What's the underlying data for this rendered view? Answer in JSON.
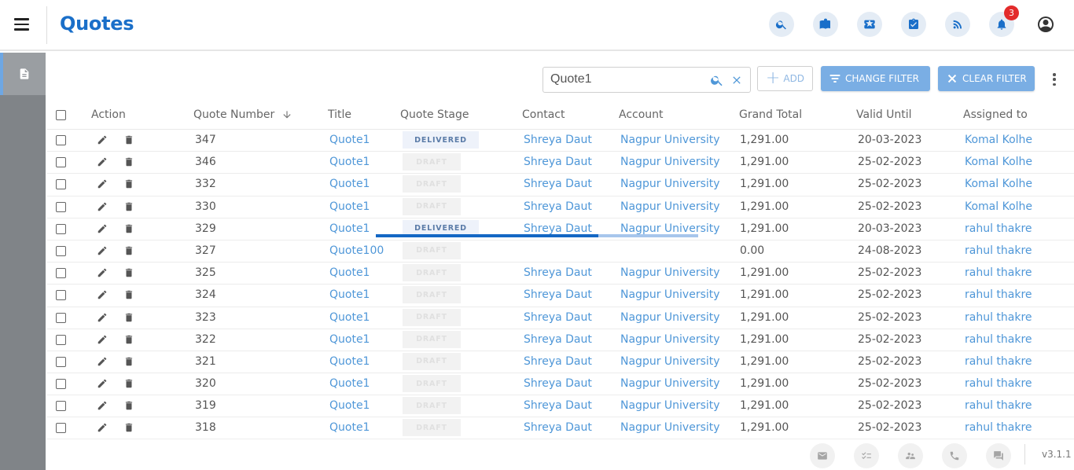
{
  "header": {
    "title": "Quotes",
    "notification_count": "3",
    "icons": [
      "search-icon",
      "book-icon",
      "ticket-icon",
      "task-icon",
      "rss-icon",
      "bell-icon",
      "account-icon"
    ]
  },
  "toolbar": {
    "search_value": "Quote1",
    "add_label": "ADD",
    "change_filter_label": "CHANGE FILTER",
    "clear_filter_label": "CLEAR FILTER"
  },
  "table": {
    "headers": {
      "action": "Action",
      "quote_number": "Quote Number",
      "title": "Title",
      "quote_stage": "Quote Stage",
      "contact": "Contact",
      "account": "Account",
      "grand_total": "Grand Total",
      "valid_until": "Valid Until",
      "assigned_to": "Assigned to"
    },
    "rows": [
      {
        "number": "347",
        "title": "Quote1",
        "stage": "DELIVERED",
        "contact": "Shreya Daut",
        "account": "Nagpur University",
        "total": "1,291.00",
        "valid": "20-03-2023",
        "assigned": "Komal Kolhe"
      },
      {
        "number": "346",
        "title": "Quote1",
        "stage": "DRAFT",
        "contact": "Shreya Daut",
        "account": "Nagpur University",
        "total": "1,291.00",
        "valid": "25-02-2023",
        "assigned": "Komal Kolhe"
      },
      {
        "number": "332",
        "title": "Quote1",
        "stage": "DRAFT",
        "contact": "Shreya Daut",
        "account": "Nagpur University",
        "total": "1,291.00",
        "valid": "25-02-2023",
        "assigned": "Komal Kolhe"
      },
      {
        "number": "330",
        "title": "Quote1",
        "stage": "DRAFT",
        "contact": "Shreya Daut",
        "account": "Nagpur University",
        "total": "1,291.00",
        "valid": "25-02-2023",
        "assigned": "Komal Kolhe"
      },
      {
        "number": "329",
        "title": "Quote1",
        "stage": "DELIVERED",
        "contact": "Shreya Daut",
        "account": "Nagpur University",
        "total": "1,291.00",
        "valid": "20-03-2023",
        "assigned": "rahul thakre"
      },
      {
        "number": "327",
        "title": "Quote100",
        "stage": "DRAFT",
        "contact": "",
        "account": "",
        "total": "0.00",
        "valid": "24-08-2023",
        "assigned": "rahul thakre"
      },
      {
        "number": "325",
        "title": "Quote1",
        "stage": "DRAFT",
        "contact": "Shreya Daut",
        "account": "Nagpur University",
        "total": "1,291.00",
        "valid": "25-02-2023",
        "assigned": "rahul thakre"
      },
      {
        "number": "324",
        "title": "Quote1",
        "stage": "DRAFT",
        "contact": "Shreya Daut",
        "account": "Nagpur University",
        "total": "1,291.00",
        "valid": "25-02-2023",
        "assigned": "rahul thakre"
      },
      {
        "number": "323",
        "title": "Quote1",
        "stage": "DRAFT",
        "contact": "Shreya Daut",
        "account": "Nagpur University",
        "total": "1,291.00",
        "valid": "25-02-2023",
        "assigned": "rahul thakre"
      },
      {
        "number": "322",
        "title": "Quote1",
        "stage": "DRAFT",
        "contact": "Shreya Daut",
        "account": "Nagpur University",
        "total": "1,291.00",
        "valid": "25-02-2023",
        "assigned": "rahul thakre"
      },
      {
        "number": "321",
        "title": "Quote1",
        "stage": "DRAFT",
        "contact": "Shreya Daut",
        "account": "Nagpur University",
        "total": "1,291.00",
        "valid": "25-02-2023",
        "assigned": "rahul thakre"
      },
      {
        "number": "320",
        "title": "Quote1",
        "stage": "DRAFT",
        "contact": "Shreya Daut",
        "account": "Nagpur University",
        "total": "1,291.00",
        "valid": "25-02-2023",
        "assigned": "rahul thakre"
      },
      {
        "number": "319",
        "title": "Quote1",
        "stage": "DRAFT",
        "contact": "Shreya Daut",
        "account": "Nagpur University",
        "total": "1,291.00",
        "valid": "25-02-2023",
        "assigned": "rahul thakre"
      },
      {
        "number": "318",
        "title": "Quote1",
        "stage": "DRAFT",
        "contact": "Shreya Daut",
        "account": "Nagpur University",
        "total": "1,291.00",
        "valid": "25-02-2023",
        "assigned": "rahul thakre"
      }
    ]
  },
  "loading_progress": 0.69,
  "footer": {
    "icons": [
      "email-icon",
      "checklist-icon",
      "meeting-icon",
      "phone-icon",
      "chat-icon"
    ],
    "version": "v3.1.1"
  },
  "colors": {
    "brand": "#1a6fc9",
    "link": "#4f97d8",
    "filter_button": "#7aaee4",
    "badge": "#e32b2b",
    "sidebar": "#808488"
  }
}
